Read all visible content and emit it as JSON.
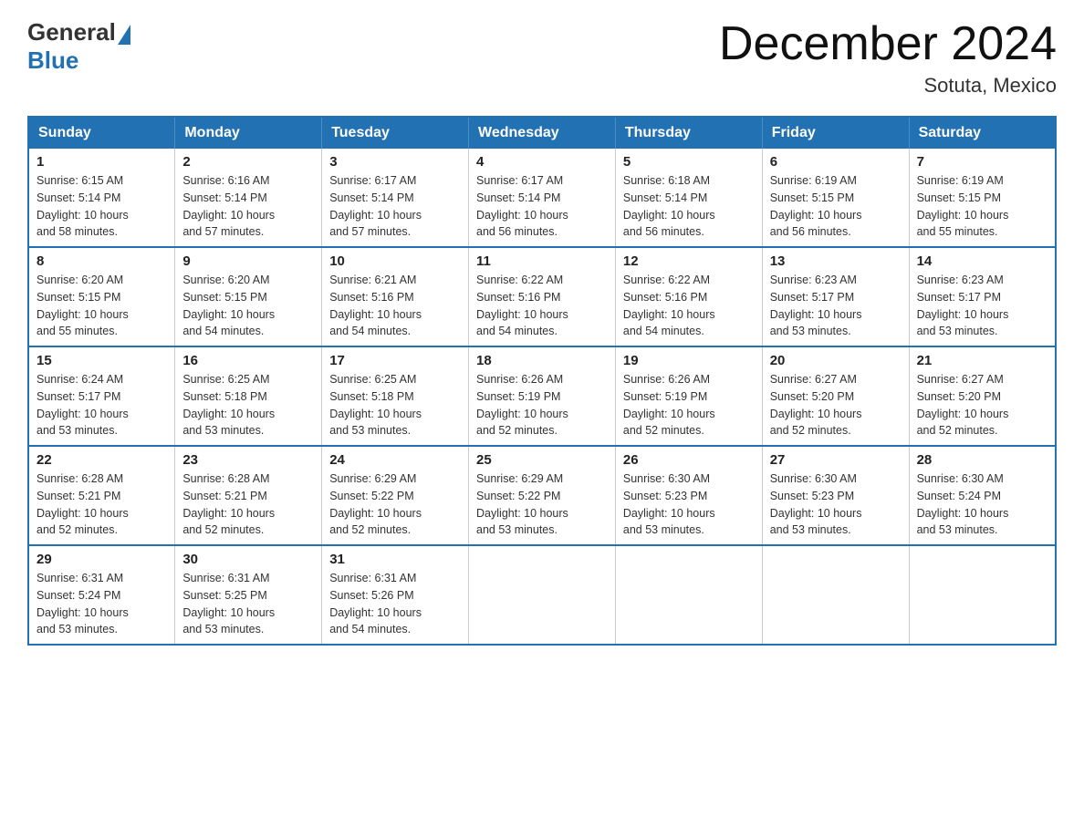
{
  "header": {
    "logo_general": "General",
    "logo_blue": "Blue",
    "title": "December 2024",
    "location": "Sotuta, Mexico"
  },
  "days_of_week": [
    "Sunday",
    "Monday",
    "Tuesday",
    "Wednesday",
    "Thursday",
    "Friday",
    "Saturday"
  ],
  "weeks": [
    [
      {
        "day": "1",
        "sunrise": "6:15 AM",
        "sunset": "5:14 PM",
        "daylight": "10 hours and 58 minutes."
      },
      {
        "day": "2",
        "sunrise": "6:16 AM",
        "sunset": "5:14 PM",
        "daylight": "10 hours and 57 minutes."
      },
      {
        "day": "3",
        "sunrise": "6:17 AM",
        "sunset": "5:14 PM",
        "daylight": "10 hours and 57 minutes."
      },
      {
        "day": "4",
        "sunrise": "6:17 AM",
        "sunset": "5:14 PM",
        "daylight": "10 hours and 56 minutes."
      },
      {
        "day": "5",
        "sunrise": "6:18 AM",
        "sunset": "5:14 PM",
        "daylight": "10 hours and 56 minutes."
      },
      {
        "day": "6",
        "sunrise": "6:19 AM",
        "sunset": "5:15 PM",
        "daylight": "10 hours and 56 minutes."
      },
      {
        "day": "7",
        "sunrise": "6:19 AM",
        "sunset": "5:15 PM",
        "daylight": "10 hours and 55 minutes."
      }
    ],
    [
      {
        "day": "8",
        "sunrise": "6:20 AM",
        "sunset": "5:15 PM",
        "daylight": "10 hours and 55 minutes."
      },
      {
        "day": "9",
        "sunrise": "6:20 AM",
        "sunset": "5:15 PM",
        "daylight": "10 hours and 54 minutes."
      },
      {
        "day": "10",
        "sunrise": "6:21 AM",
        "sunset": "5:16 PM",
        "daylight": "10 hours and 54 minutes."
      },
      {
        "day": "11",
        "sunrise": "6:22 AM",
        "sunset": "5:16 PM",
        "daylight": "10 hours and 54 minutes."
      },
      {
        "day": "12",
        "sunrise": "6:22 AM",
        "sunset": "5:16 PM",
        "daylight": "10 hours and 54 minutes."
      },
      {
        "day": "13",
        "sunrise": "6:23 AM",
        "sunset": "5:17 PM",
        "daylight": "10 hours and 53 minutes."
      },
      {
        "day": "14",
        "sunrise": "6:23 AM",
        "sunset": "5:17 PM",
        "daylight": "10 hours and 53 minutes."
      }
    ],
    [
      {
        "day": "15",
        "sunrise": "6:24 AM",
        "sunset": "5:17 PM",
        "daylight": "10 hours and 53 minutes."
      },
      {
        "day": "16",
        "sunrise": "6:25 AM",
        "sunset": "5:18 PM",
        "daylight": "10 hours and 53 minutes."
      },
      {
        "day": "17",
        "sunrise": "6:25 AM",
        "sunset": "5:18 PM",
        "daylight": "10 hours and 53 minutes."
      },
      {
        "day": "18",
        "sunrise": "6:26 AM",
        "sunset": "5:19 PM",
        "daylight": "10 hours and 52 minutes."
      },
      {
        "day": "19",
        "sunrise": "6:26 AM",
        "sunset": "5:19 PM",
        "daylight": "10 hours and 52 minutes."
      },
      {
        "day": "20",
        "sunrise": "6:27 AM",
        "sunset": "5:20 PM",
        "daylight": "10 hours and 52 minutes."
      },
      {
        "day": "21",
        "sunrise": "6:27 AM",
        "sunset": "5:20 PM",
        "daylight": "10 hours and 52 minutes."
      }
    ],
    [
      {
        "day": "22",
        "sunrise": "6:28 AM",
        "sunset": "5:21 PM",
        "daylight": "10 hours and 52 minutes."
      },
      {
        "day": "23",
        "sunrise": "6:28 AM",
        "sunset": "5:21 PM",
        "daylight": "10 hours and 52 minutes."
      },
      {
        "day": "24",
        "sunrise": "6:29 AM",
        "sunset": "5:22 PM",
        "daylight": "10 hours and 52 minutes."
      },
      {
        "day": "25",
        "sunrise": "6:29 AM",
        "sunset": "5:22 PM",
        "daylight": "10 hours and 53 minutes."
      },
      {
        "day": "26",
        "sunrise": "6:30 AM",
        "sunset": "5:23 PM",
        "daylight": "10 hours and 53 minutes."
      },
      {
        "day": "27",
        "sunrise": "6:30 AM",
        "sunset": "5:23 PM",
        "daylight": "10 hours and 53 minutes."
      },
      {
        "day": "28",
        "sunrise": "6:30 AM",
        "sunset": "5:24 PM",
        "daylight": "10 hours and 53 minutes."
      }
    ],
    [
      {
        "day": "29",
        "sunrise": "6:31 AM",
        "sunset": "5:24 PM",
        "daylight": "10 hours and 53 minutes."
      },
      {
        "day": "30",
        "sunrise": "6:31 AM",
        "sunset": "5:25 PM",
        "daylight": "10 hours and 53 minutes."
      },
      {
        "day": "31",
        "sunrise": "6:31 AM",
        "sunset": "5:26 PM",
        "daylight": "10 hours and 54 minutes."
      },
      null,
      null,
      null,
      null
    ]
  ],
  "labels": {
    "sunrise": "Sunrise:",
    "sunset": "Sunset:",
    "daylight": "Daylight:"
  }
}
